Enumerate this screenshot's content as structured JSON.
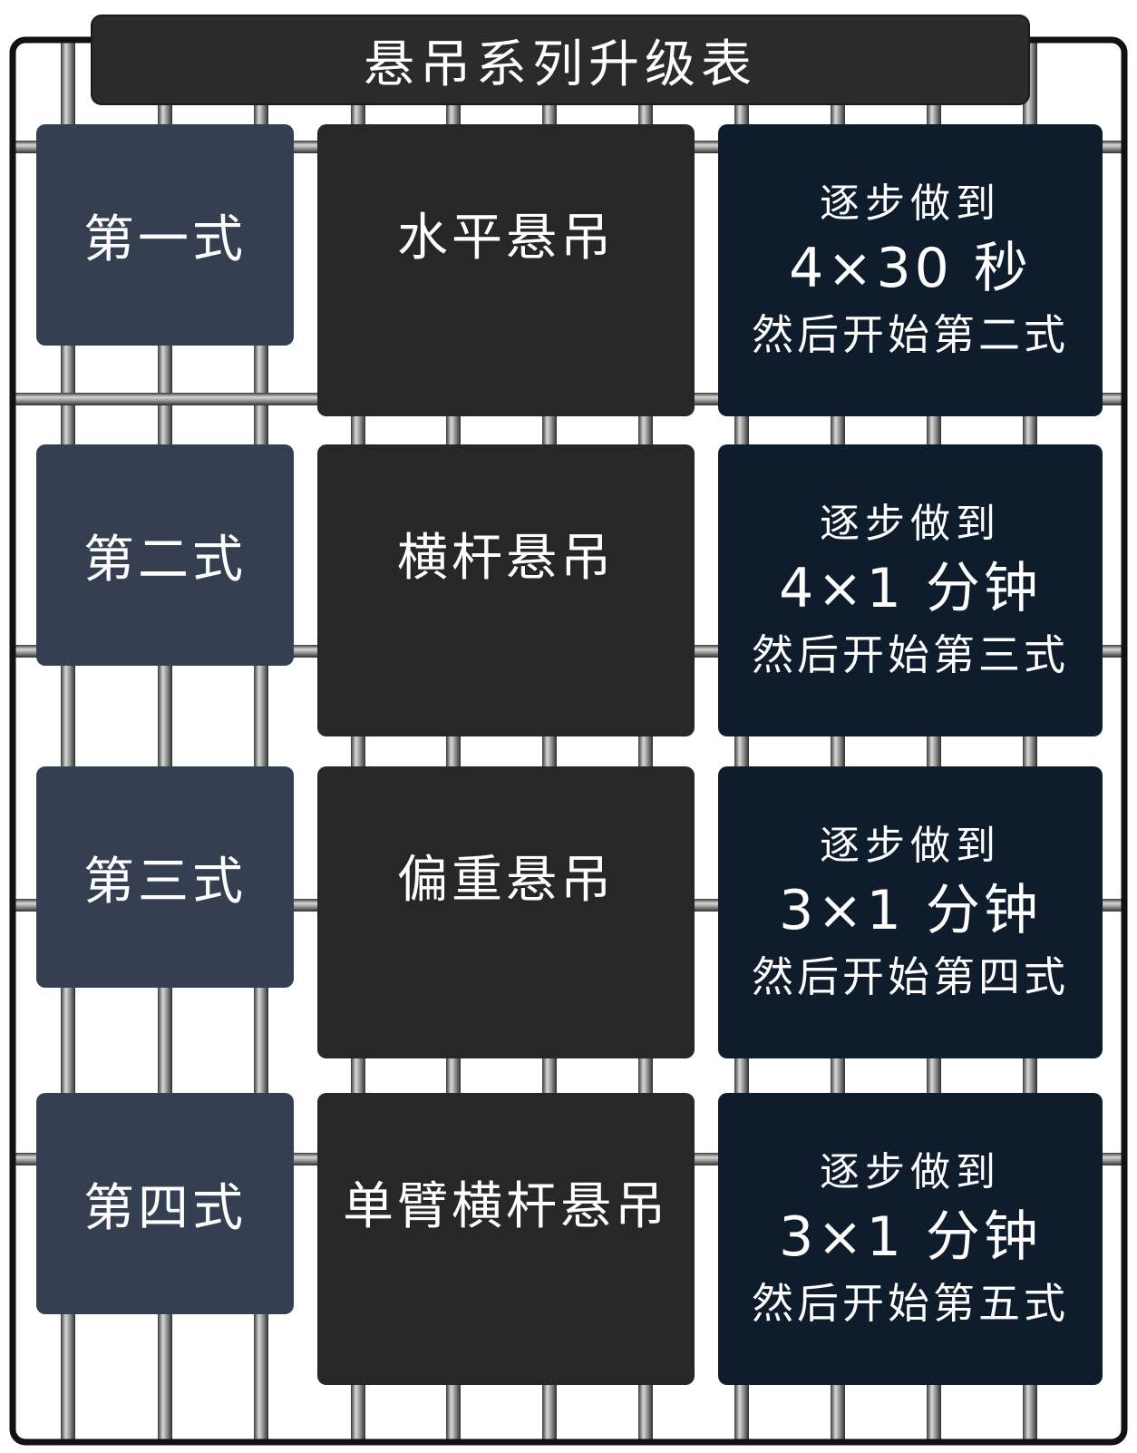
{
  "title": "悬吊系列升级表",
  "rows": [
    {
      "stage": "第一式",
      "exercise": "水平悬吊",
      "goal_top": "逐步做到",
      "goal_value": "4×30 秒",
      "goal_next": "然后开始第二式"
    },
    {
      "stage": "第二式",
      "exercise": "横杆悬吊",
      "goal_top": "逐步做到",
      "goal_value": "4×1 分钟",
      "goal_next": "然后开始第三式"
    },
    {
      "stage": "第三式",
      "exercise": "偏重悬吊",
      "goal_top": "逐步做到",
      "goal_value": "3×1 分钟",
      "goal_next": "然后开始第四式"
    },
    {
      "stage": "第四式",
      "exercise": "单臂横杆悬吊",
      "goal_top": "逐步做到",
      "goal_value": "3×1 分钟",
      "goal_next": "然后开始第五式"
    }
  ],
  "colors": {
    "title_bg": "#2b2b2b",
    "stage_bg": "#353f52",
    "exercise_bg": "#272727",
    "goal_bg": "#0f1c2c",
    "wire": "#8a8a8a",
    "frame": "#111111"
  }
}
